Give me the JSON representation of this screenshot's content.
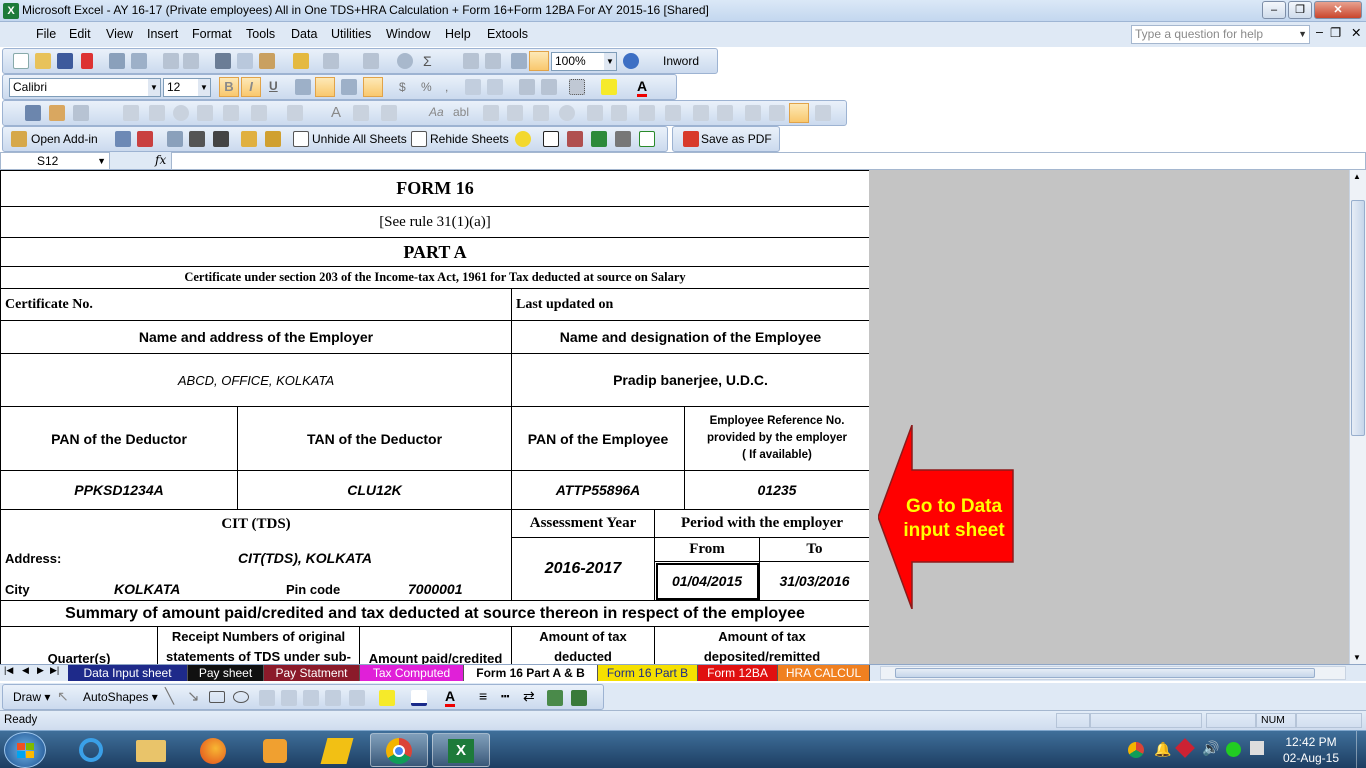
{
  "window": {
    "title": "Microsoft Excel - AY 16-17 (Private employees)  All in One TDS+HRA Calculation + Form 16+Form 12BA For AY 2015-16  [Shared]"
  },
  "menu": [
    "File",
    "Edit",
    "View",
    "Insert",
    "Format",
    "Tools",
    "Data",
    "Utilities",
    "Window",
    "Help",
    "Extools"
  ],
  "help_box": {
    "placeholder": "Type a question for help"
  },
  "toolbar": {
    "zoom": "100%",
    "inword_label": "Inword",
    "font_name": "Calibri",
    "font_size": "12",
    "bold_label": "B",
    "italic_label": "I",
    "underline_label": "U",
    "open_addin_label": "Open Add-in",
    "unhide_label": "Unhide All Sheets",
    "rehide_label": "Rehide Sheets",
    "save_pdf_label": "Save as PDF"
  },
  "formula_bar": {
    "name_box": "S12",
    "fx": "fx",
    "formula": ""
  },
  "form": {
    "title": "FORM 16",
    "rule": "[See rule 31(1)(a)]",
    "part": "PART A",
    "certificate_heading": "Certificate under section 203 of the Income-tax Act, 1961 for Tax deducted at source on Salary",
    "certificate_no_label": "Certificate No.",
    "last_updated_label": "Last updated on",
    "employer_heading": "Name and address of the Employer",
    "employee_heading": "Name and designation of the Employee",
    "employer_value": "ABCD, OFFICE, KOLKATA",
    "employee_value": "Pradip banerjee, U.D.C.",
    "pan_deductor_label": "PAN of the Deductor",
    "tan_deductor_label": "TAN of the Deductor",
    "pan_employee_label": "PAN of the Employee",
    "emp_ref_label_1": "Employee Reference No.",
    "emp_ref_label_2": "provided by the employer",
    "emp_ref_label_3": "( If available)",
    "pan_deductor_value": "PPKSD1234A",
    "tan_deductor_value": "CLU12K",
    "pan_employee_value": "ATTP55896A",
    "emp_ref_value": "01235",
    "cit_label": "CIT (TDS)",
    "assessment_year_label": "Assessment Year",
    "period_label": "Period with the employer",
    "address_label": "Address:",
    "address_value": "CIT(TDS), KOLKATA",
    "from_label": "From",
    "to_label": "To",
    "assessment_year_value": "2016-2017",
    "city_label": "City",
    "city_value": "KOLKATA",
    "pincode_label": "Pin code",
    "pincode_value": "7000001",
    "from_value": "01/04/2015",
    "to_value": "31/03/2016",
    "summary_heading": "Summary of amount paid/credited and tax deducted at source thereon in respect of the employee",
    "col_quarter": "Quarter(s)",
    "col_receipt_1": "Receipt Numbers of original",
    "col_receipt_2": "statements of TDS under sub-",
    "col_amount_paid": "Amount paid/credited",
    "col_tax_deducted_1": "Amount of tax",
    "col_tax_deducted_2": "deducted",
    "col_tax_deposited_1": "Amount of tax",
    "col_tax_deposited_2": "deposited/remitted"
  },
  "callout": {
    "line1": "Go to Data",
    "line2": "input sheet",
    "color": "#ff0000",
    "text_color": "#ffff00"
  },
  "sheet_tabs": [
    {
      "label": "Data Input sheet",
      "bg": "#1e2a8a",
      "fg": "#ffffff"
    },
    {
      "label": "Pay sheet",
      "bg": "#111111",
      "fg": "#ffffff"
    },
    {
      "label": "Pay Statment",
      "bg": "#8b1a2a",
      "fg": "#ffffff"
    },
    {
      "label": "Tax Computed",
      "bg": "#e020d8",
      "fg": "#ffffff"
    },
    {
      "label": "Form 16 Part A & B",
      "bg": "#ffffff",
      "fg": "#000000"
    },
    {
      "label": "Form 16 Part B",
      "bg": "#f5e000",
      "fg": "#1a2a8a"
    },
    {
      "label": "Form 12BA",
      "bg": "#e01010",
      "fg": "#ffffff"
    },
    {
      "label": "HRA CALCUL",
      "bg": "#f08020",
      "fg": "#ffffff"
    }
  ],
  "drawbar": {
    "draw_label": "Draw",
    "autoshapes_label": "AutoShapes"
  },
  "status": {
    "ready": "Ready",
    "num": "NUM"
  },
  "taskbar": {
    "time": "12:42 PM",
    "date": "02-Aug-15"
  }
}
